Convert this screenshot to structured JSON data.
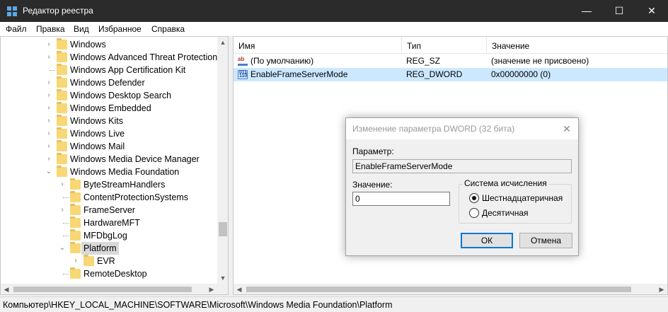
{
  "window": {
    "title": "Редактор реестра",
    "min_glyph": "—",
    "max_glyph": "☐",
    "close_glyph": "✕"
  },
  "menu": [
    "Файл",
    "Правка",
    "Вид",
    "Избранное",
    "Справка"
  ],
  "tree": {
    "items": [
      {
        "label": "Windows",
        "level": 0,
        "arrow": "›"
      },
      {
        "label": "Windows Advanced Threat Protection",
        "level": 0,
        "arrow": "›"
      },
      {
        "label": "Windows App Certification Kit",
        "level": 0,
        "arrow": ""
      },
      {
        "label": "Windows Defender",
        "level": 0,
        "arrow": "›"
      },
      {
        "label": "Windows Desktop Search",
        "level": 0,
        "arrow": "›"
      },
      {
        "label": "Windows Embedded",
        "level": 0,
        "arrow": "›"
      },
      {
        "label": "Windows Kits",
        "level": 0,
        "arrow": "›"
      },
      {
        "label": "Windows Live",
        "level": 0,
        "arrow": "›"
      },
      {
        "label": "Windows Mail",
        "level": 0,
        "arrow": "›"
      },
      {
        "label": "Windows Media Device Manager",
        "level": 0,
        "arrow": "›"
      },
      {
        "label": "Windows Media Foundation",
        "level": 0,
        "arrow": "⌄"
      },
      {
        "label": "ByteStreamHandlers",
        "level": 1,
        "arrow": "›"
      },
      {
        "label": "ContentProtectionSystems",
        "level": 1,
        "arrow": ""
      },
      {
        "label": "FrameServer",
        "level": 1,
        "arrow": "›"
      },
      {
        "label": "HardwareMFT",
        "level": 1,
        "arrow": ""
      },
      {
        "label": "MFDbgLog",
        "level": 1,
        "arrow": ""
      },
      {
        "label": "Platform",
        "level": 1,
        "arrow": "⌄",
        "selected": true
      },
      {
        "label": "EVR",
        "level": 2,
        "arrow": "›"
      },
      {
        "label": "RemoteDesktop",
        "level": 1,
        "arrow": ""
      }
    ],
    "scroll_up": "▲",
    "scroll_down": "▼",
    "scroll_left": "◀",
    "scroll_right": "▶"
  },
  "list": {
    "columns": {
      "name": "Имя",
      "type": "Тип",
      "value": "Значение"
    },
    "rows": [
      {
        "icon": "string-value-icon",
        "name": "(По умолчанию)",
        "type": "REG_SZ",
        "value": "(значение не присвоено)",
        "selected": false
      },
      {
        "icon": "dword-value-icon",
        "name": "EnableFrameServerMode",
        "type": "REG_DWORD",
        "value": "0x00000000 (0)",
        "selected": true
      }
    ],
    "string_icon_glyph": "ab",
    "dword_icon_glyph": "011\n110",
    "scroll_left": "◀",
    "scroll_right": "▶"
  },
  "status": {
    "path": "Компьютер\\HKEY_LOCAL_MACHINE\\SOFTWARE\\Microsoft\\Windows Media Foundation\\Platform"
  },
  "dialog": {
    "title": "Изменение параметра DWORD (32 бита)",
    "close_glyph": "✕",
    "param_label": "Параметр:",
    "param_value": "EnableFrameServerMode",
    "value_label": "Значение:",
    "value_value": "0",
    "base_group_label": "Система исчисления",
    "radio_hex": "Шестнадцатеричная",
    "radio_dec": "Десятичная",
    "hex_selected": true,
    "ok_label": "ОК",
    "cancel_label": "Отмена"
  },
  "colors": {
    "titlebar": "#2b2b2b",
    "selection": "#cce8ff",
    "folder": "#f8d775",
    "accent": "#0078d7"
  }
}
